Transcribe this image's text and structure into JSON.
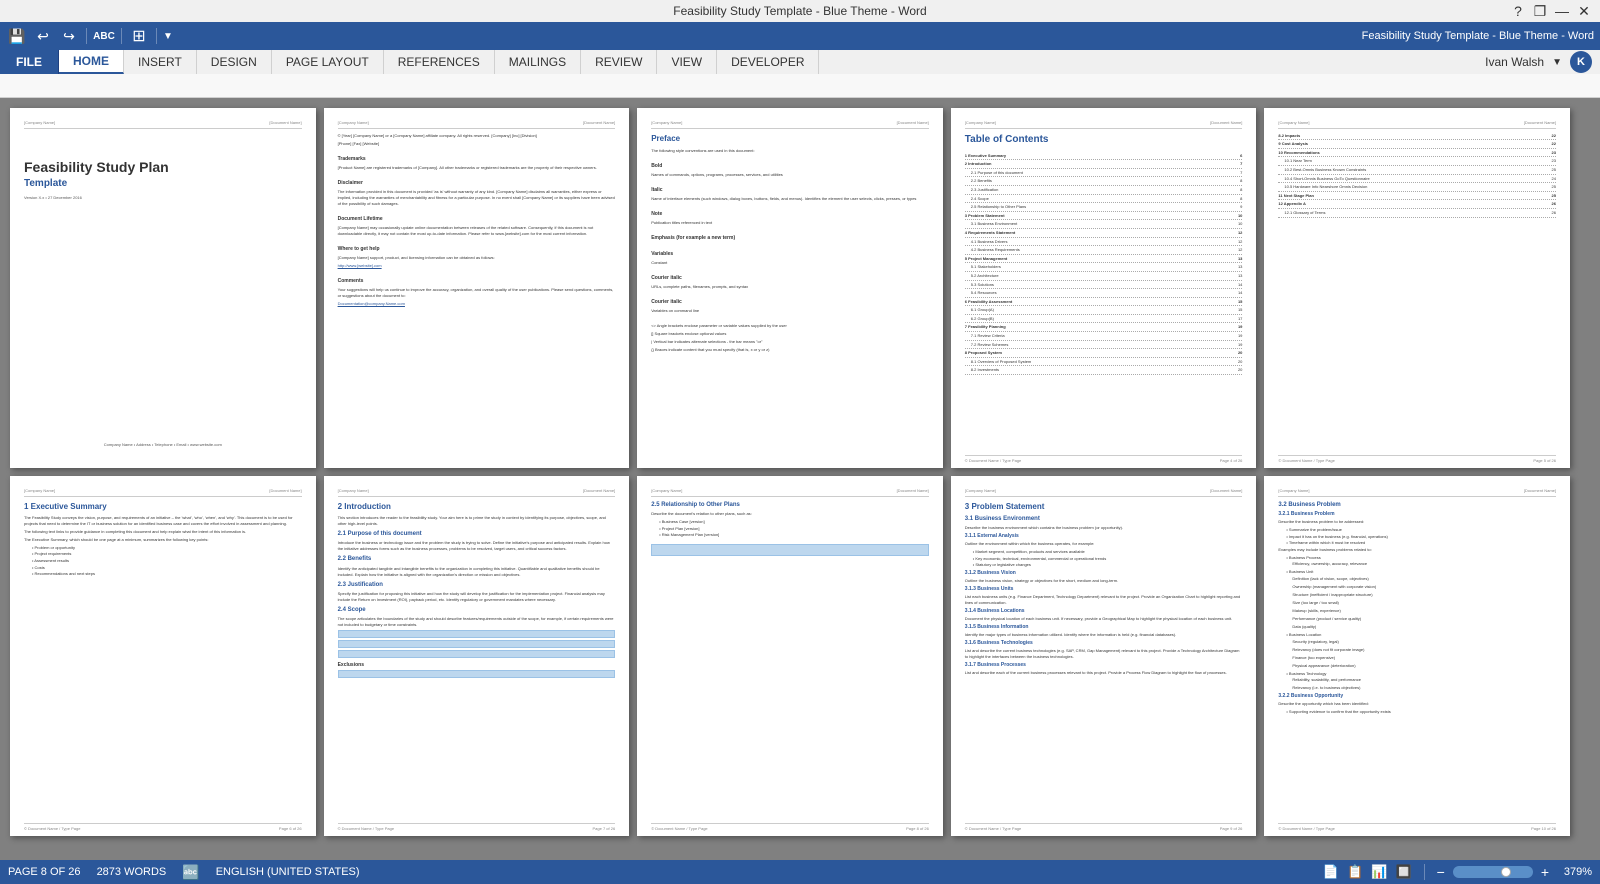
{
  "titleBar": {
    "title": "Feasibility Study Template - Blue Theme - Word",
    "helpBtn": "?",
    "restoreBtn": "❐",
    "minimizeBtn": "—",
    "closeBtn": "✕"
  },
  "quickAccess": {
    "saveIcon": "💾",
    "undoIcon": "↩",
    "redoIcon": "↪",
    "spellIcon": "ABC",
    "customizeIcon": "▼"
  },
  "ribbon": {
    "fileLabel": "FILE",
    "tabs": [
      "HOME",
      "INSERT",
      "DESIGN",
      "PAGE LAYOUT",
      "REFERENCES",
      "MAILINGS",
      "REVIEW",
      "VIEW",
      "DEVELOPER"
    ],
    "activeTab": "HOME",
    "userLabel": "Ivan Walsh",
    "userInitial": "K"
  },
  "pages": [
    {
      "id": "page1",
      "type": "cover",
      "title": "Feasibility Study Plan",
      "subtitle": "Template",
      "version": "Version X.x • 27 December 2016",
      "footerText": "Company Name • Address • Telephone • Email • www.website.com",
      "headerLeft": "[Company Name]",
      "headerRight": "[Document Name]"
    },
    {
      "id": "page2",
      "type": "legal",
      "headerLeft": "[Company Name]",
      "headerRight": "[Document Name]",
      "sections": [
        {
          "title": "Trademarks",
          "text": "[Product Name] are registered trademarks of [Company]. All other trademarks or registered trademarks are the property of their respective owners."
        },
        {
          "title": "Disclaimer",
          "text": "The information provided in this document is provided 'as is' without warranty of any kind. [Company Name] disclaims all warranties, either express or implied, including the warranties of merchantability and fitness for a particular purpose. In no event shall [Company Name] be liable for any damages whatsoever including direct, indirect, incidental, consequential, loss of business profits or special damages, even if [Company Name] or its suppliers have been advised of the possibility of such damages."
        },
        {
          "title": "Document Lifetime",
          "text": "[Company Name] may occasionally update online documentation between releases of the related software. Consequently, if this document is not downloadable directly, it may not contain the most up-to-date information. Please refer to www.[website].com for the most current information."
        },
        {
          "title": "Where to get help",
          "text": "[Company Name] support, product, and licensing information can be obtained as follows:"
        },
        {
          "title": "Comments",
          "text": "Your suggestions will help us continue to improve the accuracy, organization, and overall quality of the user publications."
        }
      ]
    },
    {
      "id": "page3",
      "type": "preface",
      "headerLeft": "[Company Name]",
      "headerRight": "[Document Name]",
      "prefaceTitle": "Preface",
      "prefaceSubtitle": "The following style conventions are used in this document:",
      "conventions": [
        "Bold",
        "Italic",
        "Courier italic",
        "Note",
        "Variables on command line",
        "<>",
        "[]",
        "|",
        "{}"
      ]
    },
    {
      "id": "page4",
      "type": "toc",
      "headerLeft": "[Company Name]",
      "headerRight": "[Document Name]",
      "tocTitle": "Table of Contents",
      "items": [
        {
          "num": "1",
          "label": "Executive Summary",
          "page": "6"
        },
        {
          "num": "2",
          "label": "Introduction",
          "page": "7"
        },
        {
          "num": "2.1",
          "label": "Purpose of this document",
          "page": "7"
        },
        {
          "num": "2.2",
          "label": "Benefits",
          "page": "8"
        },
        {
          "num": "2.3",
          "label": "Justification",
          "page": "8"
        },
        {
          "num": "2.4",
          "label": "Scope",
          "page": "8"
        },
        {
          "num": "2.5",
          "label": "Relationship to Other Plans",
          "page": "9"
        },
        {
          "num": "3",
          "label": "Problem Statement",
          "page": "10"
        },
        {
          "num": "3.1",
          "label": "Business Environment",
          "page": "10"
        },
        {
          "num": "4",
          "label": "Requirements Statement",
          "page": "12"
        },
        {
          "num": "4.1",
          "label": "Business Drivers",
          "page": "12"
        },
        {
          "num": "4.2",
          "label": "Business Requirements",
          "page": "12"
        },
        {
          "num": "5",
          "label": "Project Management",
          "page": "13"
        },
        {
          "num": "6",
          "label": "Feasibility Assessment",
          "page": "15"
        },
        {
          "num": "7",
          "label": "Feasibility Planning",
          "page": "19"
        },
        {
          "num": "8",
          "label": "Proposed System",
          "page": "20"
        },
        {
          "num": "8.2",
          "label": "Impacts",
          "page": "22"
        },
        {
          "num": "9",
          "label": "Cost Analysis",
          "page": "22"
        },
        {
          "num": "10",
          "label": "Recommendations",
          "page": "23"
        },
        {
          "num": "11",
          "label": "Next Stage Plan",
          "page": "25"
        },
        {
          "num": "12",
          "label": "Appendix A",
          "page": "26"
        }
      ]
    },
    {
      "id": "page5",
      "type": "toc2",
      "headerLeft": "[Company Name]",
      "headerRight": "[Document Name]",
      "extraItems": [
        {
          "label": "8.2 Impacts",
          "page": "22"
        },
        {
          "label": "9 Cost Analysis",
          "page": "22"
        },
        {
          "label": "10 Recommendations",
          "page": "23"
        },
        {
          "label": "10.1 Near Term",
          "page": "23"
        },
        {
          "label": "10.3 Short-Omnis Business Known Constraints",
          "page": "25"
        },
        {
          "label": "10.4 Short-Omnis Business GoTo Questionnaire",
          "page": "24"
        },
        {
          "label": "10.5 Hardware Infra Nearshore Omnis Decision",
          "page": "25"
        },
        {
          "label": "11 Next Stage Plan",
          "page": "25"
        },
        {
          "label": "12 Appendix A",
          "page": "26"
        },
        {
          "label": "12.1 Glossary of Terms",
          "page": "26"
        }
      ]
    },
    {
      "id": "page6",
      "type": "exec_summary",
      "headerLeft": "[Company Name]",
      "headerRight": "[Document Name]",
      "sectionNum": "1",
      "sectionTitle": "Executive Summary",
      "bodyText": "The Feasibility Study conveys the vision, purpose, and requirements of an initiative – the 'what', 'who', 'when', and 'why'. This document is to be used for projects that need to determine the IT or business solution for an identified business case and covers the effort involved in assessment and planning.",
      "bullets": [
        "Problem or opportunity",
        "Project requirements",
        "Assessment results",
        "Costs",
        "Recommendations and next steps"
      ]
    },
    {
      "id": "page7",
      "type": "introduction",
      "headerLeft": "[Company Name]",
      "headerRight": "[Document Name]",
      "sectionNum": "2",
      "sectionTitle": "Introduction",
      "subSections": [
        {
          "num": "2.1",
          "title": "Purpose of this document"
        },
        {
          "num": "2.2",
          "title": "Benefits"
        },
        {
          "num": "2.3",
          "title": "Justification"
        },
        {
          "num": "2.4",
          "title": "Scope"
        },
        {
          "num": "2.5",
          "title": "Relationship to Other Plans"
        }
      ]
    },
    {
      "id": "page8",
      "type": "relationship",
      "headerLeft": "[Company Name]",
      "headerRight": "[Document Name]",
      "subSectionNum": "2.5",
      "subSectionTitle": "Relationship to Other Plans",
      "bullets": [
        "Business Case [version]",
        "Project Plan [version]",
        "Risk Management Plan [version]"
      ]
    },
    {
      "id": "page9",
      "type": "problem_statement",
      "headerLeft": "[Company Name]",
      "headerRight": "[Document Name]",
      "sectionNum": "3",
      "sectionTitle": "Problem Statement",
      "subSectionNum": "3.1",
      "subSectionTitle": "Business Environment",
      "subSubSections": [
        {
          "num": "3.1.1",
          "title": "External Analysis"
        },
        {
          "num": "3.1.2",
          "title": "Business Vision"
        },
        {
          "num": "3.1.3",
          "title": "Business Units"
        },
        {
          "num": "3.1.4",
          "title": "Business Locations"
        },
        {
          "num": "3.1.5",
          "title": "Business Information"
        },
        {
          "num": "3.1.6",
          "title": "Business Technologies"
        },
        {
          "num": "3.1.7",
          "title": "Business Processes"
        }
      ]
    },
    {
      "id": "page10",
      "type": "business_problem",
      "headerLeft": "[Company Name]",
      "headerRight": "[Document Name]",
      "sectionNum": "3.2",
      "sectionTitle": "Business Problem",
      "subSections": [
        {
          "num": "3.2.1",
          "title": "Business Problem"
        },
        {
          "num": "3.2.2",
          "title": "Business Opportunity"
        }
      ]
    }
  ],
  "statusBar": {
    "pageInfo": "PAGE 8 OF 26",
    "wordCount": "2873 WORDS",
    "language": "ENGLISH (UNITED STATES)",
    "zoomPercent": "379%",
    "viewIcons": [
      "📄",
      "📋",
      "📊",
      "🔲"
    ]
  }
}
